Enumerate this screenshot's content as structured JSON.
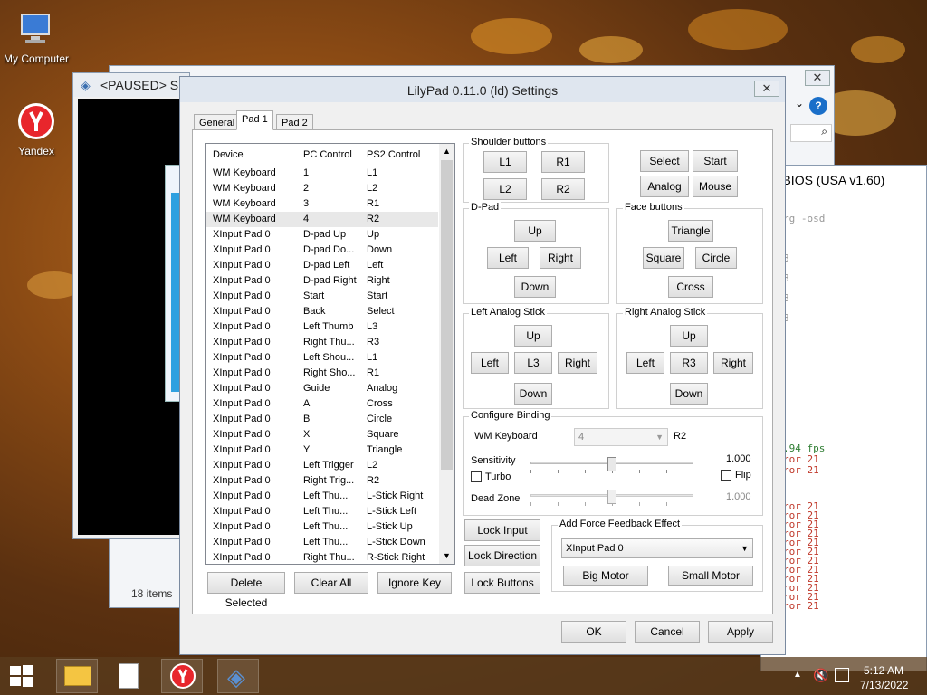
{
  "desktop": {
    "icons": [
      {
        "label": "My Computer"
      },
      {
        "label": "Yandex"
      }
    ]
  },
  "bg_window": {
    "title": "<PAUSED> SL",
    "items_count": "18 items"
  },
  "bios_window": {
    "title": "ng BIOS (USA v1.60)",
    "console_lines": [
      "rg -osd",
      "8",
      "8",
      "8",
      "8",
      ".94 fps",
      "ror 21",
      "ror 21",
      "ror 21",
      "ror 21",
      "ror 21",
      "ror 21",
      "ror 21",
      "ror 21",
      "ror 21",
      "ror 21",
      "ror 21",
      "ror 21",
      "ror 21",
      "ror 21"
    ]
  },
  "dialog": {
    "title": "LilyPad 0.11.0 (ld) Settings",
    "tabs": [
      "General",
      "Pad 1",
      "Pad 2"
    ],
    "columns": [
      "Device",
      "PC Control",
      "PS2 Control"
    ],
    "rows": [
      [
        "WM Keyboard",
        "1",
        "L1"
      ],
      [
        "WM Keyboard",
        "2",
        "L2"
      ],
      [
        "WM Keyboard",
        "3",
        "R1"
      ],
      [
        "WM Keyboard",
        "4",
        "R2"
      ],
      [
        "XInput Pad 0",
        "D-pad Up",
        "Up"
      ],
      [
        "XInput Pad 0",
        "D-pad Do...",
        "Down"
      ],
      [
        "XInput Pad 0",
        "D-pad Left",
        "Left"
      ],
      [
        "XInput Pad 0",
        "D-pad Right",
        "Right"
      ],
      [
        "XInput Pad 0",
        "Start",
        "Start"
      ],
      [
        "XInput Pad 0",
        "Back",
        "Select"
      ],
      [
        "XInput Pad 0",
        "Left Thumb",
        "L3"
      ],
      [
        "XInput Pad 0",
        "Right Thu...",
        "R3"
      ],
      [
        "XInput Pad 0",
        "Left Shou...",
        "L1"
      ],
      [
        "XInput Pad 0",
        "Right Sho...",
        "R1"
      ],
      [
        "XInput Pad 0",
        "Guide",
        "Analog"
      ],
      [
        "XInput Pad 0",
        "A",
        "Cross"
      ],
      [
        "XInput Pad 0",
        "B",
        "Circle"
      ],
      [
        "XInput Pad 0",
        "X",
        "Square"
      ],
      [
        "XInput Pad 0",
        "Y",
        "Triangle"
      ],
      [
        "XInput Pad 0",
        "Left Trigger",
        "L2"
      ],
      [
        "XInput Pad 0",
        "Right Trig...",
        "R2"
      ],
      [
        "XInput Pad 0",
        "Left Thu...",
        "L-Stick Right"
      ],
      [
        "XInput Pad 0",
        "Left Thu...",
        "L-Stick Left"
      ],
      [
        "XInput Pad 0",
        "Left Thu...",
        "L-Stick Up"
      ],
      [
        "XInput Pad 0",
        "Left Thu...",
        "L-Stick Down"
      ],
      [
        "XInput Pad 0",
        "Right Thu...",
        "R-Stick Right"
      ]
    ],
    "list_buttons": {
      "delete": "Delete Selected",
      "clear": "Clear All",
      "ignore": "Ignore Key"
    },
    "shoulder": {
      "label": "Shoulder buttons",
      "l1": "L1",
      "r1": "R1",
      "l2": "L2",
      "r2": "R2"
    },
    "misc": {
      "select": "Select",
      "start": "Start",
      "analog": "Analog",
      "mouse": "Mouse"
    },
    "dpad": {
      "label": "D-Pad",
      "up": "Up",
      "left": "Left",
      "right": "Right",
      "down": "Down"
    },
    "face": {
      "label": "Face buttons",
      "triangle": "Triangle",
      "square": "Square",
      "circle": "Circle",
      "cross": "Cross"
    },
    "lstick": {
      "label": "Left Analog Stick",
      "up": "Up",
      "left": "Left",
      "l3": "L3",
      "right": "Right",
      "down": "Down"
    },
    "rstick": {
      "label": "Right Analog Stick",
      "up": "Up",
      "left": "Left",
      "r3": "R3",
      "right": "Right",
      "down": "Down"
    },
    "binding": {
      "label": "Configure Binding",
      "device": "WM Keyboard",
      "key_value": "4",
      "ps2": "R2",
      "sensitivity_label": "Sensitivity",
      "sensitivity_value": "1.000",
      "sensitivity_level": 0.5,
      "turbo": "Turbo",
      "flip": "Flip",
      "deadzone_label": "Dead Zone",
      "deadzone_value": "1.000",
      "deadzone_level": 0.5
    },
    "lock": {
      "input": "Lock Input",
      "direction": "Lock Direction",
      "buttons": "Lock Buttons"
    },
    "ff": {
      "label": "Add Force Feedback Effect",
      "selected": "XInput Pad 0",
      "big": "Big Motor",
      "small": "Small Motor"
    },
    "footer": {
      "ok": "OK",
      "cancel": "Cancel",
      "apply": "Apply"
    }
  },
  "taskbar": {
    "time": "5:12 AM",
    "date": "7/13/2022"
  }
}
